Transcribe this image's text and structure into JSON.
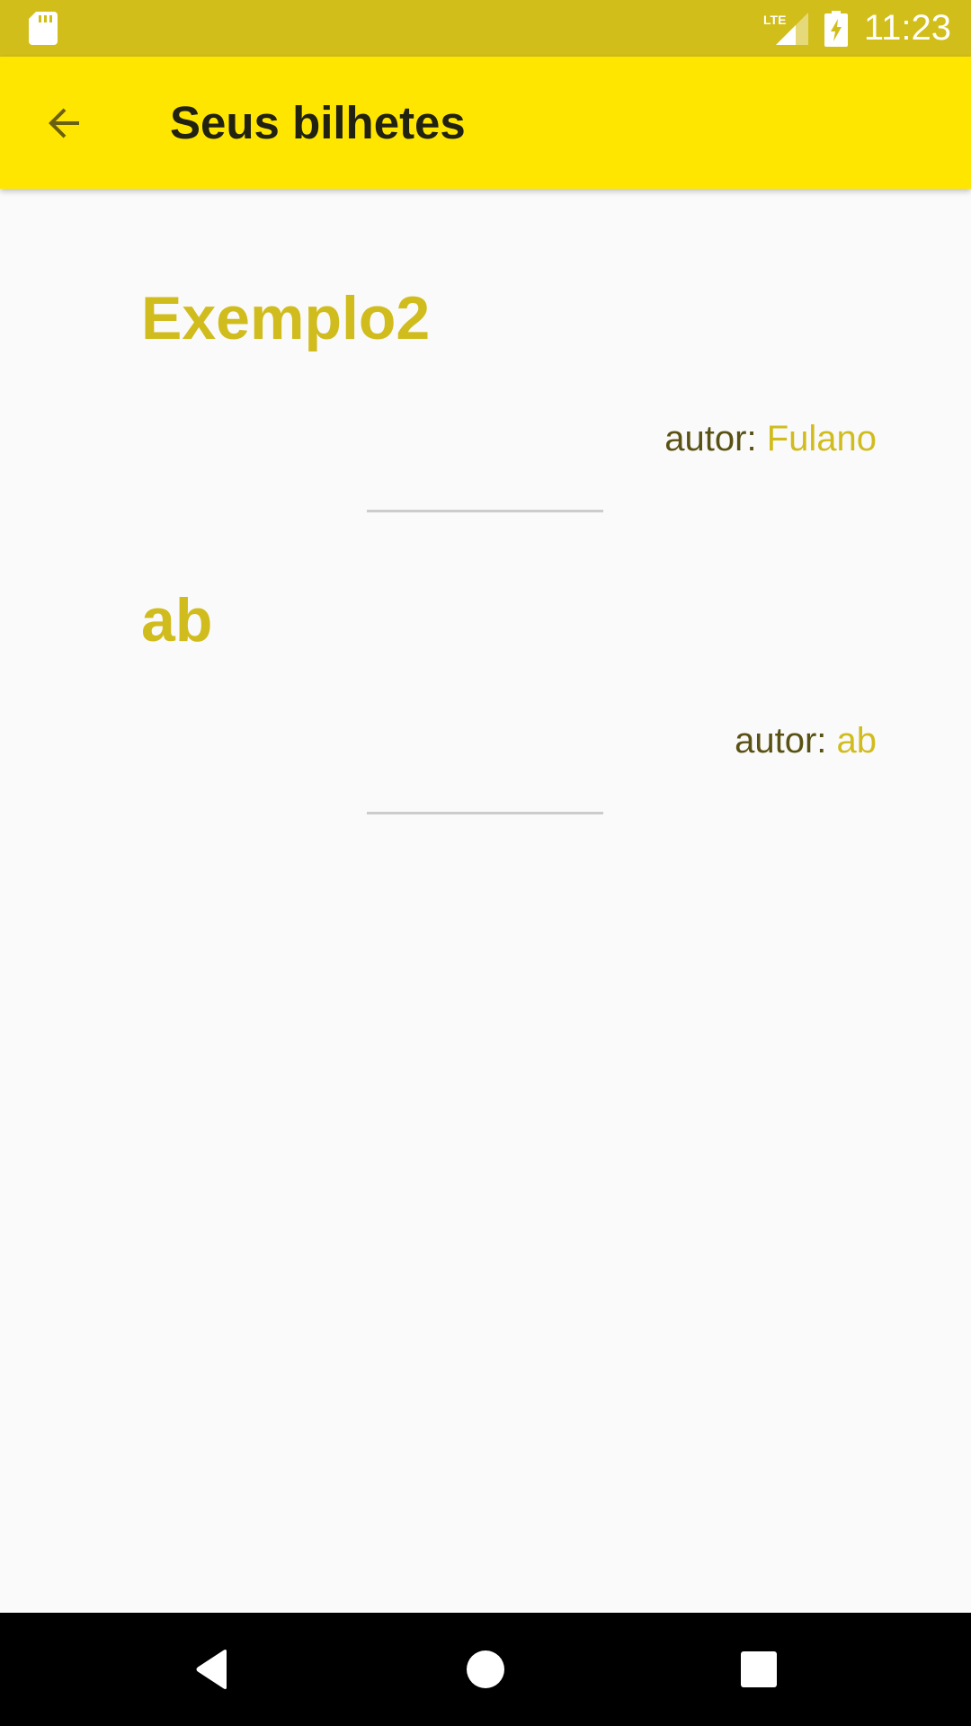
{
  "status_bar": {
    "time": "11:23",
    "network_label": "LTE",
    "left_icon": "sd-card-icon",
    "icons": [
      "lte-signal-icon",
      "battery-charging-icon"
    ],
    "color": "#d1be1a"
  },
  "app_bar": {
    "title": "Seus bilhetes",
    "back_icon": "arrow-back-icon",
    "color": "#ffe600"
  },
  "notes": [
    {
      "title": "Exemplo2",
      "author_label": "autor: ",
      "author": "Fulano"
    },
    {
      "title": "ab",
      "author_label": "autor: ",
      "author": "ab"
    }
  ],
  "nav_bar": {
    "buttons": [
      "back-triangle-icon",
      "home-circle-icon",
      "recents-square-icon"
    ]
  },
  "colors": {
    "accent": "#d1bc1e",
    "author_label": "#5a5214",
    "background": "#fafafa",
    "divider": "#cccccc"
  }
}
